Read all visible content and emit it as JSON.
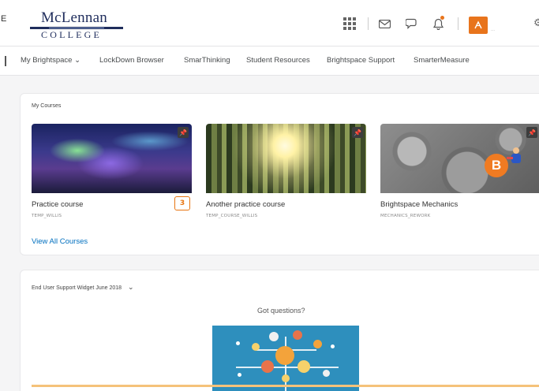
{
  "header": {
    "edge_char": "E",
    "logo": {
      "line1": "McLennan",
      "line2": "COLLEGE"
    },
    "user_name_text": "…",
    "icons": [
      "grid-icon",
      "mail-icon",
      "chat-icon",
      "bell-icon",
      "settings-icon"
    ],
    "accent_color": "#e8741c"
  },
  "nav": {
    "items": [
      {
        "label": "My Brightspace ⌄"
      },
      {
        "label": "LockDown Browser"
      },
      {
        "label": "SmarThinking"
      },
      {
        "label": "Student Resources"
      },
      {
        "label": "Brightspace Support"
      },
      {
        "label": "SmarterMeasure"
      }
    ]
  },
  "courses": {
    "title": "My Courses",
    "tiles": [
      {
        "name": "Practice course",
        "code": "TEMP_WILLIS",
        "badge": "3"
      },
      {
        "name": "Another practice course",
        "code": "TEMP_COURSE_WILLIS"
      },
      {
        "name": "Brightspace Mechanics",
        "code": "MECHANICS_REWORK"
      }
    ],
    "view_all": "View All Courses"
  },
  "widget": {
    "title": "End User Support Widget June 2018",
    "heading": "Got questions?"
  },
  "colors": {
    "link": "#006fbf",
    "badge": "#e87511",
    "illustration": "#2e8fbd"
  }
}
